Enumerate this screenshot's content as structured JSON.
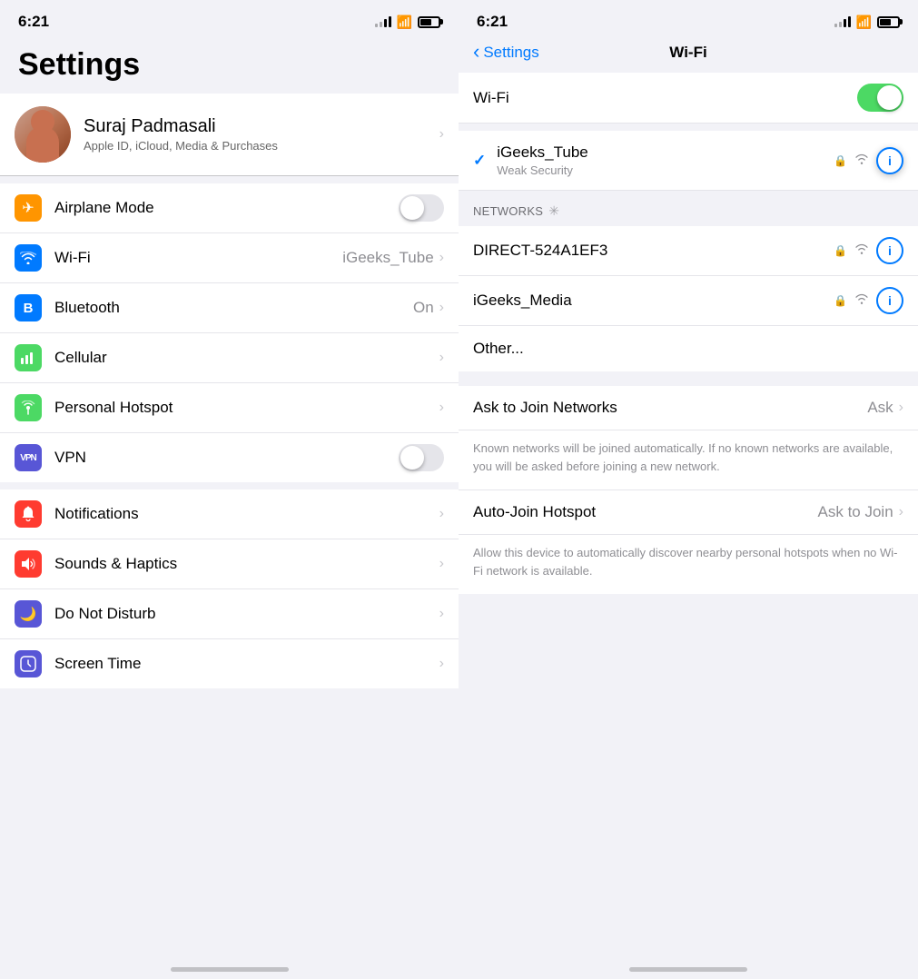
{
  "left": {
    "status": {
      "time": "6:21"
    },
    "title": "Settings",
    "profile": {
      "name": "Suraj Padmasali",
      "subtitle": "Apple ID, iCloud, Media & Purchases"
    },
    "groups": [
      {
        "id": "connectivity",
        "items": [
          {
            "id": "airplane",
            "icon": "✈",
            "iconClass": "icon-airplane",
            "label": "Airplane Mode",
            "type": "toggle",
            "toggleOn": false
          },
          {
            "id": "wifi",
            "icon": "📶",
            "iconClass": "icon-wifi",
            "label": "Wi-Fi",
            "value": "iGeeks_Tube",
            "type": "chevron",
            "highlighted": true
          },
          {
            "id": "bluetooth",
            "icon": "⬡",
            "iconClass": "icon-bluetooth",
            "label": "Bluetooth",
            "value": "On",
            "type": "chevron"
          },
          {
            "id": "cellular",
            "icon": "◉",
            "iconClass": "icon-cellular",
            "label": "Cellular",
            "type": "chevron"
          },
          {
            "id": "hotspot",
            "icon": "⊕",
            "iconClass": "icon-hotspot",
            "label": "Personal Hotspot",
            "type": "chevron"
          },
          {
            "id": "vpn",
            "icon": "VPN",
            "iconClass": "icon-vpn",
            "label": "VPN",
            "type": "toggle",
            "toggleOn": false
          }
        ]
      },
      {
        "id": "system",
        "items": [
          {
            "id": "notifications",
            "icon": "🔔",
            "iconClass": "icon-notifications",
            "label": "Notifications",
            "type": "chevron"
          },
          {
            "id": "sounds",
            "icon": "🔊",
            "iconClass": "icon-sounds",
            "label": "Sounds & Haptics",
            "type": "chevron"
          },
          {
            "id": "dnd",
            "icon": "🌙",
            "iconClass": "icon-dnd",
            "label": "Do Not Disturb",
            "type": "chevron"
          },
          {
            "id": "screentime",
            "icon": "⏳",
            "iconClass": "icon-screentime",
            "label": "Screen Time",
            "type": "chevron"
          }
        ]
      }
    ]
  },
  "right": {
    "status": {
      "time": "6:21"
    },
    "nav": {
      "back_label": "Settings",
      "title": "Wi-Fi"
    },
    "wifi_toggle_label": "Wi-Fi",
    "connected_network": {
      "name": "iGeeks_Tube",
      "security": "Weak Security"
    },
    "networks_header": "NETWORKS",
    "networks": [
      {
        "id": "direct",
        "name": "DIRECT-524A1EF3"
      },
      {
        "id": "media",
        "name": "iGeeks_Media"
      },
      {
        "id": "other",
        "name": "Other..."
      }
    ],
    "ask_to_join": {
      "label": "Ask to Join Networks",
      "value": "Ask",
      "description": "Known networks will be joined automatically. If no known networks are available, you will be asked before joining a new network."
    },
    "auto_join": {
      "label": "Auto-Join Hotspot",
      "value": "Ask to Join",
      "description": "Allow this device to automatically discover nearby personal hotspots when no Wi-Fi network is available."
    }
  }
}
